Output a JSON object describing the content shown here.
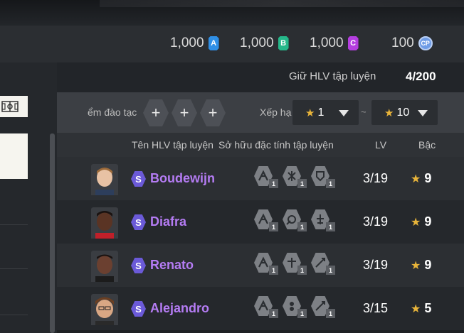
{
  "currencies": [
    {
      "value": "1,000",
      "icon": "a-gem-icon",
      "letter": "A",
      "color": "#2f8fe6"
    },
    {
      "value": "1,000",
      "icon": "b-gem-icon",
      "letter": "B",
      "color": "#25b88a"
    },
    {
      "value": "1,000",
      "icon": "c-gem-icon",
      "letter": "C",
      "color": "#b43ee0"
    },
    {
      "value": "100",
      "icon": "cp-coin-icon",
      "letter": "CP",
      "color": "#6f9ce6"
    }
  ],
  "holder": {
    "label": "Giữ HLV tập luyện",
    "count": "4/200"
  },
  "filters": {
    "training_label": "ểm đào tạc",
    "slots": [
      "+",
      "+",
      "+"
    ],
    "rank_label": "Xếp hạ",
    "rank_min": "1",
    "separator": "~",
    "rank_max": "10"
  },
  "table": {
    "headers": {
      "name": "Tên HLV tập luyện",
      "traits": "Sở hữu đặc tính tập luyện",
      "lv": "LV",
      "grade": "Bậc"
    },
    "rows": [
      {
        "badge": "S",
        "name": "Boudewijn",
        "traits": [
          "1",
          "1",
          "1"
        ],
        "lv": "3/19",
        "grade": "9"
      },
      {
        "badge": "S",
        "name": "Diafra",
        "traits": [
          "1",
          "1",
          "1"
        ],
        "lv": "3/19",
        "grade": "9"
      },
      {
        "badge": "S",
        "name": "Renato",
        "traits": [
          "1",
          "1",
          "1"
        ],
        "lv": "3/19",
        "grade": "9"
      },
      {
        "badge": "S",
        "name": "Alejandro",
        "traits": [
          "1",
          "1",
          "1"
        ],
        "lv": "3/15",
        "grade": "5"
      }
    ]
  }
}
